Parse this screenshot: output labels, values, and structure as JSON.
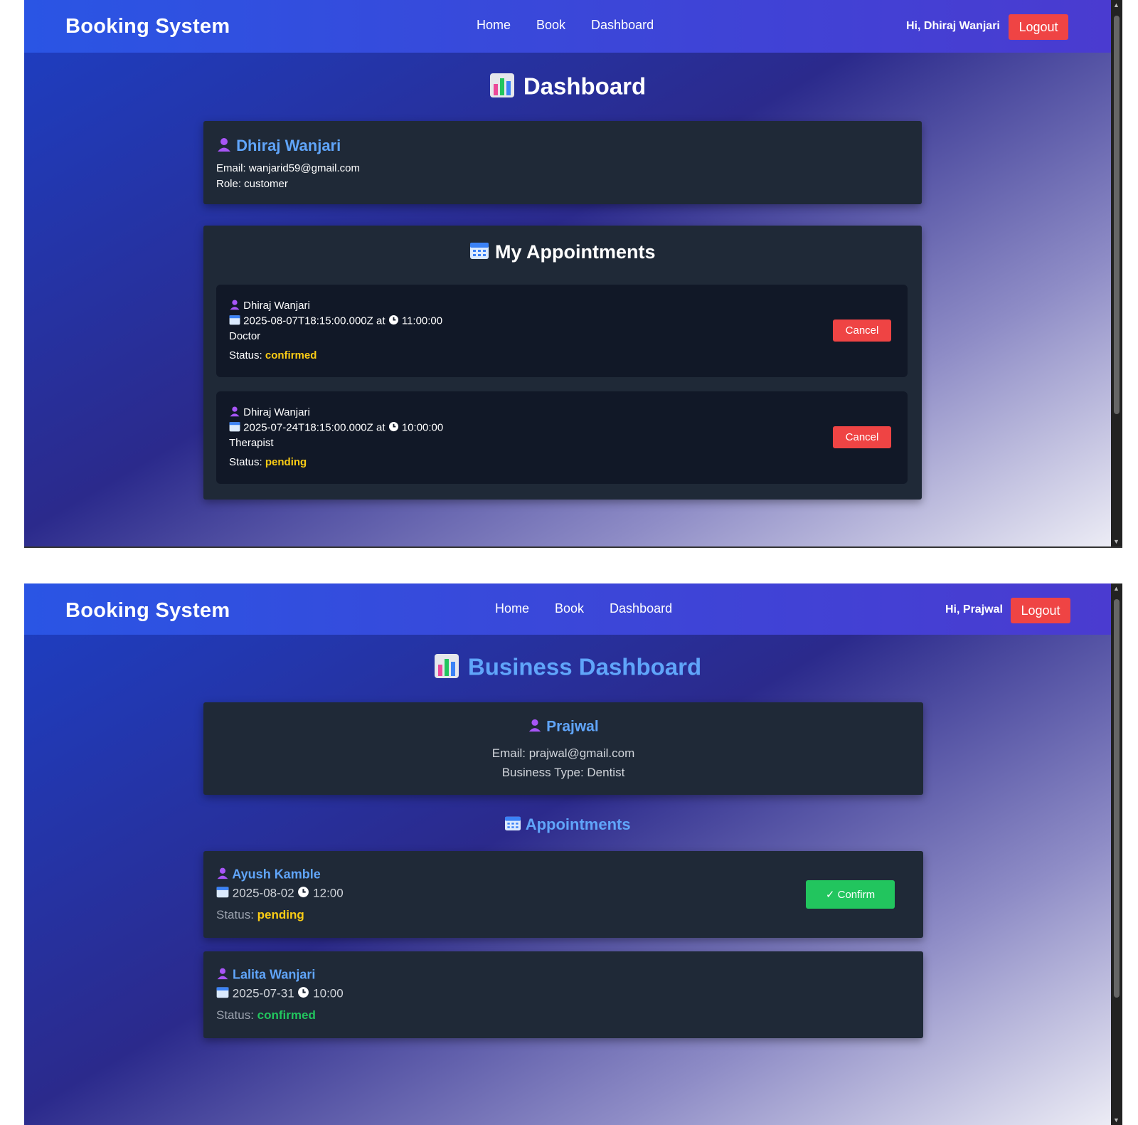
{
  "colors": {
    "accent_blue": "#60a5fa",
    "danger": "#ef4444",
    "success": "#22c55e",
    "pending": "#facc15",
    "card_bg": "#1f2937",
    "inner_bg": "#111827"
  },
  "customer_view": {
    "nav": {
      "brand": "Booking System",
      "links": [
        "Home",
        "Book",
        "Dashboard"
      ],
      "greeting": "Hi, Dhiraj Wanjari",
      "logout": "Logout"
    },
    "title": "Dashboard",
    "title_icon": "bar-chart-icon",
    "profile": {
      "name": "Dhiraj Wanjari",
      "email": "Email: wanjarid59@gmail.com",
      "role": "Role: customer"
    },
    "appointments_heading": "My Appointments",
    "appointments_icon": "calendar-icon",
    "appointments": [
      {
        "name": "Dhiraj Wanjari",
        "date": "2025-08-07T18:15:00.000Z at",
        "time": "11:00:00",
        "service": "Doctor",
        "status_label": "Status:",
        "status": "confirmed",
        "action": "Cancel"
      },
      {
        "name": "Dhiraj Wanjari",
        "date": "2025-07-24T18:15:00.000Z at",
        "time": "10:00:00",
        "service": "Therapist",
        "status_label": "Status:",
        "status": "pending",
        "action": "Cancel"
      }
    ]
  },
  "business_view": {
    "nav": {
      "brand": "Booking System",
      "links": [
        "Home",
        "Book",
        "Dashboard"
      ],
      "greeting": "Hi, Prajwal",
      "logout": "Logout"
    },
    "title": "Business Dashboard",
    "title_icon": "bar-chart-icon",
    "profile": {
      "name": "Prajwal",
      "email": "Email: prajwal@gmail.com",
      "business_type": "Business Type: Dentist"
    },
    "appointments_heading": "Appointments",
    "appointments_icon": "calendar-icon",
    "appointments": [
      {
        "name": "Ayush Kamble",
        "date": "2025-08-02",
        "time": "12:00",
        "status_label": "Status:",
        "status": "pending",
        "action": "✓ Confirm"
      },
      {
        "name": "Lalita Wanjari",
        "date": "2025-07-31",
        "time": "10:00",
        "status_label": "Status:",
        "status": "confirmed"
      }
    ]
  }
}
